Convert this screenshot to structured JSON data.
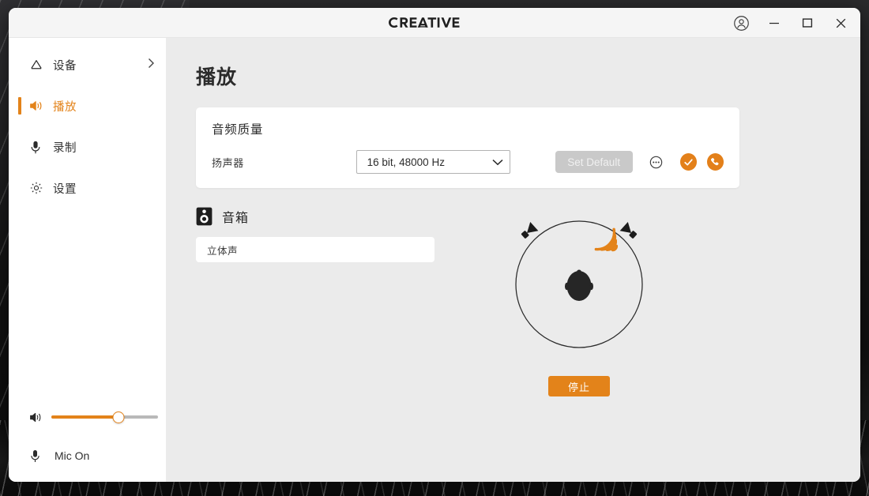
{
  "window": {
    "brand": "CREATIVE",
    "controls": {
      "account": "account-icon",
      "minimize": "minimize-icon",
      "maximize": "maximize-icon",
      "close": "close-icon"
    }
  },
  "sidebar": {
    "items": [
      {
        "label": "设备",
        "icon": "device-icon",
        "active": false,
        "has_chevron": true
      },
      {
        "label": "播放",
        "icon": "speaker-wave-icon",
        "active": true,
        "has_chevron": false
      },
      {
        "label": "录制",
        "icon": "microphone-icon",
        "active": false,
        "has_chevron": false
      },
      {
        "label": "设置",
        "icon": "gear-icon",
        "active": false,
        "has_chevron": false
      }
    ],
    "volume": {
      "icon": "volume-icon",
      "percent": 63
    },
    "mic": {
      "icon": "microphone-icon",
      "label": "Mic On"
    }
  },
  "main": {
    "page_title": "播放",
    "audio_quality": {
      "card_title": "音频质量",
      "speaker_label": "扬声器",
      "format_value": "16 bit, 48000 Hz",
      "set_default_label": "Set Default",
      "more_icon": "more-options-icon",
      "default_device_icon": "check-circle-icon",
      "default_comm_icon": "phone-circle-icon"
    },
    "speakers": {
      "icon": "speaker-cabinet-icon",
      "title": "音箱",
      "mode_value": "立体声",
      "test": {
        "stop_button_label": "停止",
        "listener_icon": "head-top-view-icon",
        "left_speaker_icon": "speaker-cone-icon",
        "right_speaker_icon": "speaker-cone-icon",
        "active_channel": "right",
        "wave_icon": "sound-wave-icon"
      }
    }
  },
  "colors": {
    "accent": "#e3831a",
    "content_bg": "#ebebeb",
    "panel_bg": "#ffffff",
    "titlebar_bg": "#f5f5f5",
    "disabled_btn": "#c9c9c9",
    "text": "#2d2d2d"
  }
}
